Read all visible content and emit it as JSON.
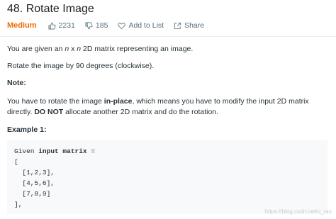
{
  "problem": {
    "title": "48. Rotate Image",
    "difficulty": "Medium",
    "likes": "2231",
    "dislikes": "185",
    "add_to_list": "Add to List",
    "share": "Share"
  },
  "colors": {
    "difficulty": "#ef6c00",
    "text": "#263238",
    "code_bg": "#f7f9fa"
  },
  "icons": {
    "likes": "thumbs-up-icon",
    "dislikes": "thumbs-down-icon",
    "add_to_list": "heart-icon",
    "share": "share-icon"
  },
  "description": {
    "p1_before": "You are given an ",
    "p1_n1": "n",
    "p1_x": " x ",
    "p1_n2": "n",
    "p1_after": " 2D matrix representing an image.",
    "p2": "Rotate the image by 90 degrees (clockwise).",
    "note_label": "Note:",
    "p4_before": "You have to rotate the image ",
    "p4_link": "in-place",
    "p4_after": ", which means you have to modify the input 2D matrix directly. ",
    "p4_bold": "DO NOT",
    "p4_end": " allocate another 2D matrix and do the rotation.",
    "example_label": "Example 1:"
  },
  "example": {
    "line1_prefix": "Given ",
    "line1_kw": "input matrix",
    "line1_suffix": " =",
    "lines": [
      "[",
      "  [1,2,3],",
      "  [4,5,6],",
      "  [7,8,9]",
      "],"
    ]
  },
  "watermark": "https://blog.csdn.net/u_rao"
}
